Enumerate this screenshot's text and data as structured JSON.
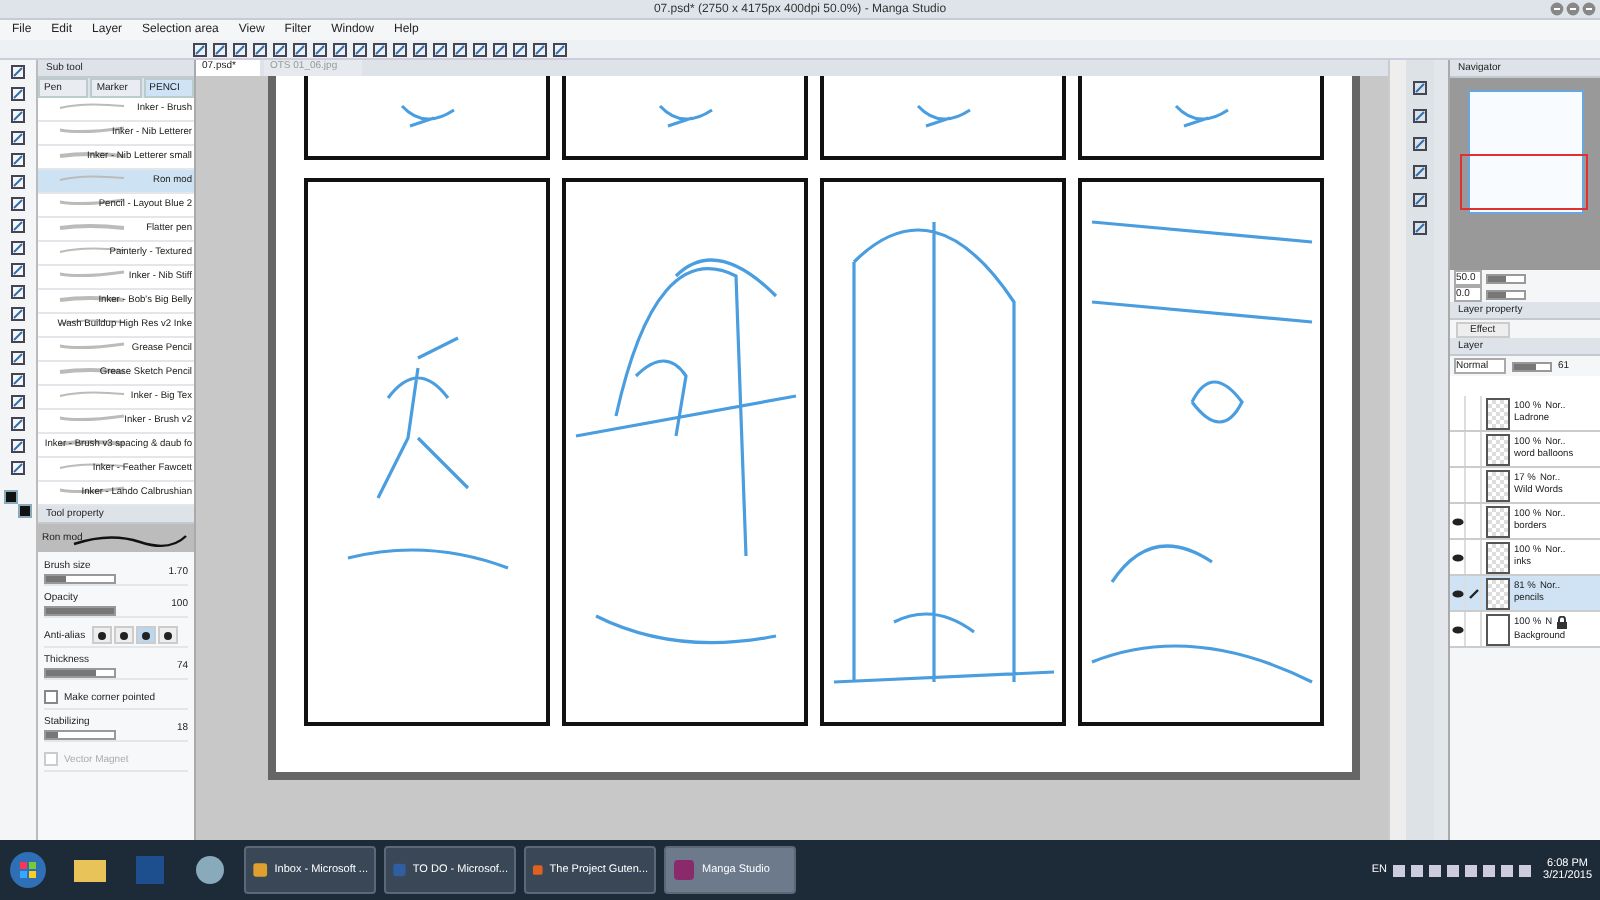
{
  "window": {
    "title": "07.psd* (2750 x 4175px 400dpi 50.0%) - Manga Studio"
  },
  "menu": [
    "File",
    "Edit",
    "Layer",
    "Selection area",
    "View",
    "Filter",
    "Window",
    "Help"
  ],
  "document_tabs": [
    {
      "label": "07.psd*",
      "selected": true
    },
    {
      "label": "OTS 01_06.jpg",
      "selected": false
    }
  ],
  "sub_tool": {
    "title": "Sub tool",
    "tabs": [
      {
        "label": "Pen",
        "selected": false
      },
      {
        "label": "Marker",
        "selected": false
      },
      {
        "label": "PENCI",
        "selected": true
      }
    ],
    "brushes": [
      {
        "name": "Inker - Brush",
        "selected": false
      },
      {
        "name": "Inker - Nib Letterer",
        "selected": false
      },
      {
        "name": "Inker - Nib Letterer small",
        "selected": false
      },
      {
        "name": "Ron mod",
        "selected": true
      },
      {
        "name": "Pencil - Layout Blue 2",
        "selected": false
      },
      {
        "name": "Flatter pen",
        "selected": false
      },
      {
        "name": "Painterly - Textured",
        "selected": false
      },
      {
        "name": "Inker - Nib Stiff",
        "selected": false
      },
      {
        "name": "Inker - Bob's Big Belly",
        "selected": false
      },
      {
        "name": "Wash Buildup High Res v2 Inke",
        "selected": false
      },
      {
        "name": "Grease Pencil",
        "selected": false
      },
      {
        "name": "Grease Sketch Pencil",
        "selected": false
      },
      {
        "name": "Inker - Big Tex",
        "selected": false
      },
      {
        "name": "Inker - Brush v2",
        "selected": false
      },
      {
        "name": "Inker - Brush v3 spacing & daub fo",
        "selected": false
      },
      {
        "name": "Inker - Feather Fawcett",
        "selected": false
      },
      {
        "name": "Inker - Lando Calbrushian",
        "selected": false
      }
    ]
  },
  "tool_property": {
    "title": "Tool property",
    "brush_name": "Ron mod",
    "settings": [
      {
        "kind": "slider",
        "label": "Brush size",
        "value": "1.70",
        "level": 0.3
      },
      {
        "kind": "slider",
        "label": "Opacity",
        "value": "100",
        "level": 1
      },
      {
        "kind": "antialias",
        "label": "Anti-alias",
        "options": [
          {
            "selected": false
          },
          {
            "selected": false
          },
          {
            "selected": true
          },
          {
            "selected": false
          }
        ]
      },
      {
        "kind": "slider",
        "label": "Thickness",
        "value": "74",
        "level": 0.74
      },
      {
        "kind": "checkbox",
        "label": "Make corner pointed",
        "checked": false,
        "disabled": false
      },
      {
        "kind": "slider",
        "label": "Stabilizing",
        "value": "18",
        "level": 0.18
      },
      {
        "kind": "checkbox",
        "label": "Vector Magnet",
        "checked": false,
        "disabled": true
      }
    ]
  },
  "navigator": {
    "title": "Navigator",
    "zoom": "50.0",
    "zoom_slider": {
      "level": 0.5
    },
    "rotation": "0.0",
    "rotation_slider": {
      "level": 0.5
    }
  },
  "layer_property": {
    "title": "Layer property",
    "effect": "Effect"
  },
  "layer_panel": {
    "title": "Layer",
    "blend_mode": "Normal",
    "opacity_slider": {
      "level": 0.61
    },
    "opacity": "61",
    "layers": [
      {
        "name": "Ladrone",
        "opacity": "100 %",
        "mode": "Nor..",
        "visible": false,
        "editing": false,
        "locked": false,
        "selected": false
      },
      {
        "name": "word balloons",
        "opacity": "100 %",
        "mode": "Nor..",
        "visible": false,
        "editing": false,
        "locked": false,
        "selected": false
      },
      {
        "name": "Wild Words",
        "opacity": "17 %",
        "mode": "Nor..",
        "visible": false,
        "editing": false,
        "locked": false,
        "selected": false
      },
      {
        "name": "borders",
        "opacity": "100 %",
        "mode": "Nor..",
        "visible": true,
        "editing": false,
        "locked": false,
        "selected": false
      },
      {
        "name": "inks",
        "opacity": "100 %",
        "mode": "Nor..",
        "visible": true,
        "editing": false,
        "locked": false,
        "selected": false
      },
      {
        "name": "pencils",
        "opacity": "81 %",
        "mode": "Nor..",
        "visible": true,
        "editing": true,
        "locked": false,
        "selected": true
      },
      {
        "name": "Background",
        "opacity": "100 %",
        "mode": "N",
        "visible": true,
        "editing": false,
        "locked": true,
        "selected": false
      }
    ]
  },
  "taskbar": {
    "windows": [
      {
        "label": "Inbox - Microsoft ...",
        "selected": false
      },
      {
        "label": "TO DO - Microsof...",
        "selected": false
      },
      {
        "label": "The Project Guten...",
        "selected": false
      },
      {
        "label": "Manga Studio",
        "selected": true
      }
    ],
    "language": "EN",
    "time": "6:08 PM",
    "date": "3/21/2015"
  }
}
